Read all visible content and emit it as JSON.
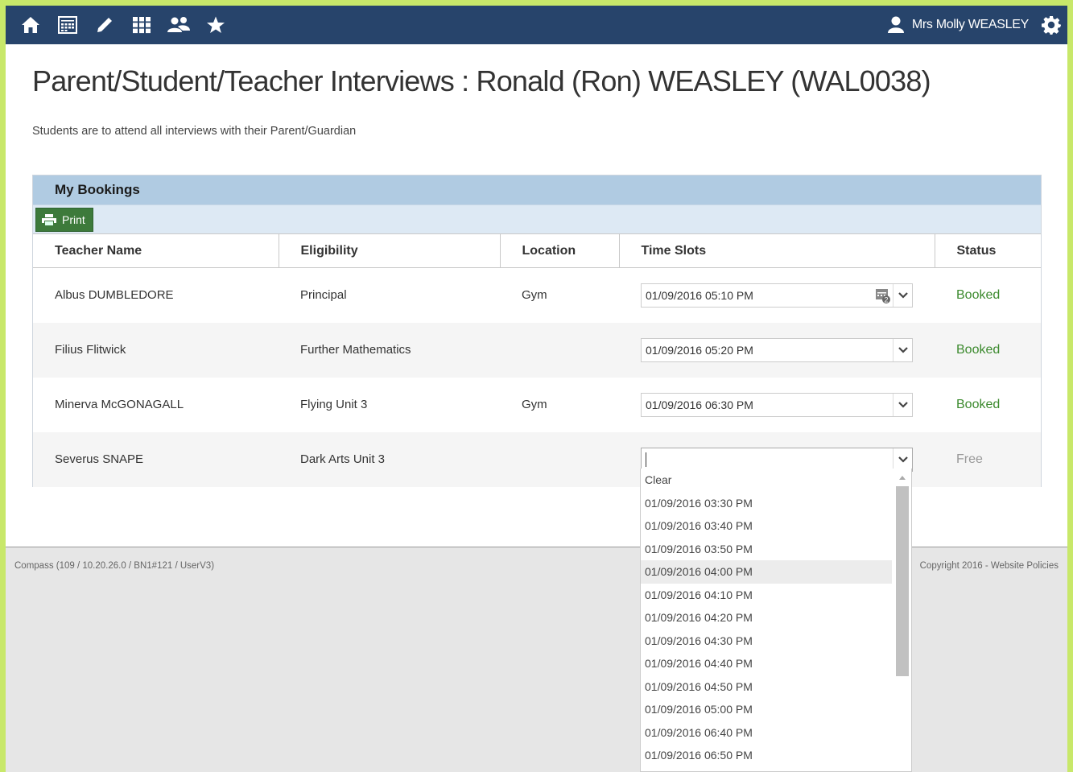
{
  "topbar": {
    "nav_icons": [
      "home-icon",
      "calendar-icon",
      "pencil-icon",
      "grid-icon",
      "people-icon",
      "star-icon"
    ],
    "user_name": "Mrs Molly WEASLEY",
    "color": "#27446b"
  },
  "page": {
    "title": "Parent/Student/Teacher Interviews : Ronald (Ron) WEASLEY (WAL0038)",
    "subtitle": "Students are to attend all interviews with their Parent/Guardian"
  },
  "bookings": {
    "header": "My Bookings",
    "print_label": "Print",
    "columns": [
      "Teacher Name",
      "Eligibility",
      "Location",
      "Time Slots",
      "Status"
    ],
    "rows": [
      {
        "teacher": "Albus DUMBLEDORE",
        "eligibility": "Principal",
        "location": "Gym",
        "slot": "01/09/2016 05:10 PM",
        "status": "Booked"
      },
      {
        "teacher": "Filius Flitwick",
        "eligibility": "Further Mathematics",
        "location": "",
        "slot": "01/09/2016 05:20 PM",
        "status": "Booked"
      },
      {
        "teacher": "Minerva McGONAGALL",
        "eligibility": "Flying Unit 3",
        "location": "Gym",
        "slot": "01/09/2016 06:30 PM",
        "status": "Booked"
      },
      {
        "teacher": "Severus SNAPE",
        "eligibility": "Dark Arts Unit 3",
        "location": "",
        "slot": "",
        "status": "Free"
      }
    ]
  },
  "dropdown": {
    "options": [
      "Clear",
      "01/09/2016 03:30 PM",
      "01/09/2016 03:40 PM",
      "01/09/2016 03:50 PM",
      "01/09/2016 04:00 PM",
      "01/09/2016 04:10 PM",
      "01/09/2016 04:20 PM",
      "01/09/2016 04:30 PM",
      "01/09/2016 04:40 PM",
      "01/09/2016 04:50 PM",
      "01/09/2016 05:00 PM",
      "01/09/2016 06:40 PM",
      "01/09/2016 06:50 PM"
    ],
    "hovered": "01/09/2016 04:00 PM"
  },
  "footer": {
    "version": "Compass (109 / 10.20.26.0 / BN1#121 / UserV3)",
    "copyright": "Copyright 2016 - Website Policies"
  },
  "colors": {
    "booked": "#3c8a2e",
    "free": "#999999",
    "panel_header": "#b0cbe2",
    "frame": "#c8e86a"
  }
}
